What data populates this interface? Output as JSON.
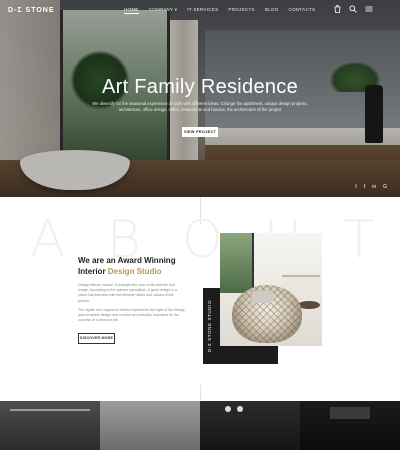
{
  "nav": {
    "logo": "D-Σ STONE",
    "menu": [
      "HOME",
      "COMPANY ▾",
      "IT SERVICES",
      "PROJECTS",
      "BLOG",
      "CONTACTS"
    ],
    "active_index": 0,
    "cart_icon": "cart-icon",
    "search_icon": "search-icon",
    "menu_icon": "hamburger-icon"
  },
  "hero": {
    "title": "Art Family Residence",
    "description": "We diversify for the seasonal experience of work with different ideas. Change the apartment, unique design projects, architecture, office design, cafes, restaurants and houses, the architecture of the project",
    "button": "VIEW PROJECT",
    "social": [
      "t",
      "f",
      "in",
      "G"
    ]
  },
  "about": {
    "bg_letters": [
      "A",
      "B",
      "O",
      "U",
      "T"
    ],
    "heading_line1": "We are an Award Winning",
    "heading_prefix": "Interior ",
    "heading_accent": "Design Studio",
    "paragraph1": "Design affects human. It changes the view of life and the self image. According to the opinion specialists, a good design is a place that interacts with the lifestyle habits and values of the person.",
    "paragraph2": "The stylish and organized interior represents the style of the fittings and complete design and comfort are primarily important for the success of a person's life.",
    "button": "DISCOVER MORE",
    "label_vertical": "D-Σ STONE STUDIO"
  },
  "colors": {
    "accent": "#b8985c",
    "dark": "#1c1c1c"
  }
}
